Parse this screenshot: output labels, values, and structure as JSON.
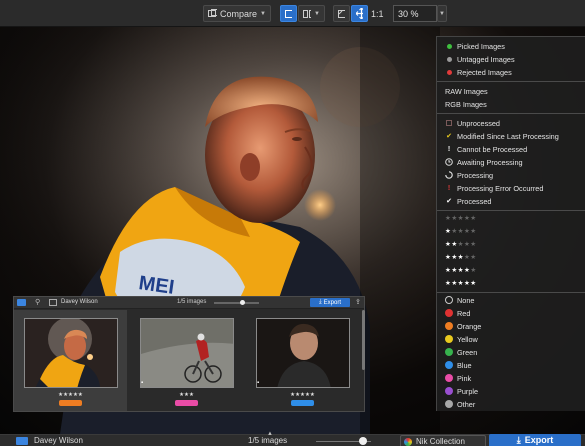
{
  "toolbar": {
    "compare_label": "Compare",
    "ratio_label": "1:1",
    "zoom_value": "30 %"
  },
  "menu": {
    "status_items": [
      {
        "label": "Picked Images",
        "color": "#3fbf3f"
      },
      {
        "label": "Untagged Images",
        "color": "#9a9a9a"
      },
      {
        "label": "Rejected Images",
        "color": "#e03a3a"
      }
    ],
    "format_items": [
      "RAW Images",
      "RGB Images"
    ],
    "processing_items": [
      {
        "label": "Unprocessed",
        "icon": "empty-square-icon"
      },
      {
        "label": "Modified Since Last Processing",
        "icon": "check-yellow-icon"
      },
      {
        "label": "Cannot be Processed",
        "icon": "exclamation-icon"
      },
      {
        "label": "Awaiting Processing",
        "icon": "clock-icon"
      },
      {
        "label": "Processing",
        "icon": "spinner-icon"
      },
      {
        "label": "Processing Error Occurred",
        "icon": "exclamation-red-icon"
      },
      {
        "label": "Processed",
        "icon": "check-icon"
      }
    ],
    "star_items": [
      "★★★★★",
      "★★★★★",
      "★★★★★",
      "★★★★★",
      "★★★★★",
      "★★★★★"
    ],
    "star_filled": [
      0,
      1,
      2,
      3,
      4,
      5
    ],
    "color_items": [
      {
        "label": "None",
        "color": "none"
      },
      {
        "label": "Red",
        "color": "#e03232"
      },
      {
        "label": "Orange",
        "color": "#ef7d22"
      },
      {
        "label": "Yellow",
        "color": "#e8c91f"
      },
      {
        "label": "Green",
        "color": "#37b24d"
      },
      {
        "label": "Blue",
        "color": "#2f8ee8"
      },
      {
        "label": "Pink",
        "color": "#e94ca6"
      },
      {
        "label": "Purple",
        "color": "#9a4fd0"
      },
      {
        "label": "Other",
        "color": "#a8a8a8"
      }
    ]
  },
  "strip": {
    "folder": "Davey Wilson",
    "count": "1/5 images",
    "export_label": "Export",
    "thumbs": [
      {
        "stars": "★★★★★",
        "tag_color": "#ef7d22"
      },
      {
        "stars": "★★★",
        "tag_color": "#e94ca6"
      },
      {
        "stars": "★★★★★",
        "tag_color": "#2f8ee8"
      }
    ]
  },
  "status": {
    "folder": "Davey Wilson",
    "count": "1/5 images",
    "nik_label": "Nik Collection",
    "export_label": "Export"
  }
}
